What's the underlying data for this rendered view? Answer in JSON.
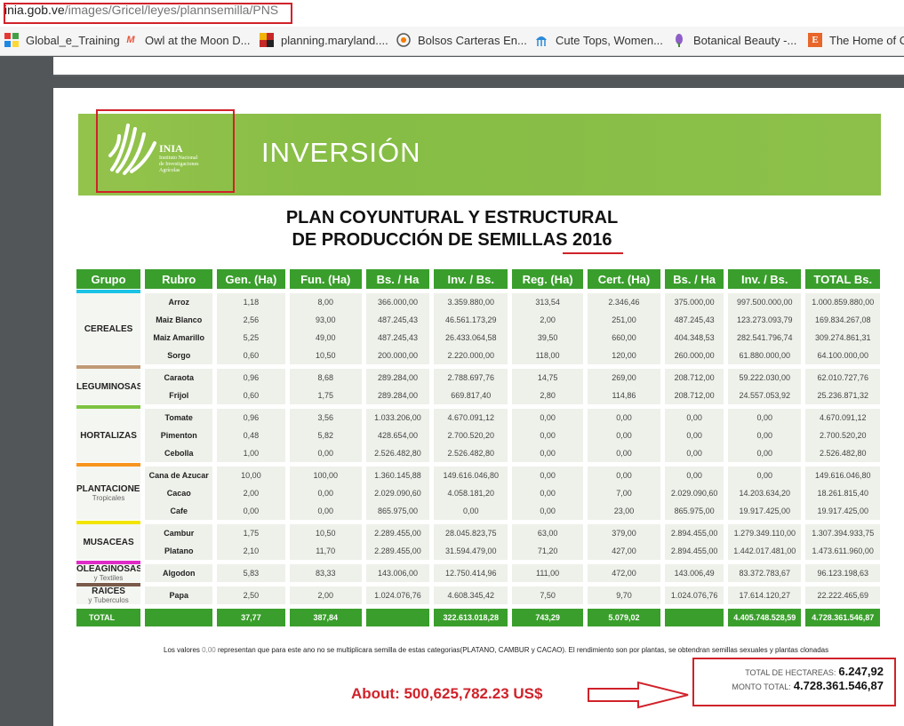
{
  "browser": {
    "url_domain": "inia.gob.ve",
    "url_path": "/images/Gricel/leyes/plannsemilla/PNS"
  },
  "bookmarks": [
    {
      "label": "Global_e_Training",
      "icon": "grid-icon"
    },
    {
      "label": "Owl at the Moon D...",
      "icon": "m-logo-icon"
    },
    {
      "label": "planning.maryland....",
      "icon": "maryland-flag-icon"
    },
    {
      "label": "Bolsos Carteras En...",
      "icon": "circle-logo-icon"
    },
    {
      "label": "Cute Tops, Women...",
      "icon": "jellyfish-icon"
    },
    {
      "label": "Botanical Beauty -...",
      "icon": "flower-icon"
    },
    {
      "label": "The Home of Cr",
      "icon": "e-logo-icon"
    }
  ],
  "document": {
    "logo_name": "INIA",
    "logo_sub": [
      "Instituto Nacional",
      "de Investigaciones",
      "Agrícolas"
    ],
    "banner_title": "INVERSIÓN",
    "title_line1": "PLAN COYUNTURAL Y ESTRUCTURAL",
    "title_line2_prefix": "DE PRODUCCIÓN DE SEMILLAS ",
    "title_year": "2016",
    "headers": [
      "Grupo",
      "Rubro",
      "Gen. (Ha)",
      "Fun. (Ha)",
      "Bs. / Ha",
      "Inv. / Bs.",
      "Reg. (Ha)",
      "Cert. (Ha)",
      "Bs. / Ha",
      "Inv. / Bs.",
      "TOTAL Bs."
    ],
    "groups": [
      {
        "name": "CEREALES",
        "sub": "",
        "color": "#19c3e6",
        "rows": [
          [
            "Arroz",
            "1,18",
            "8,00",
            "366.000,00",
            "3.359.880,00",
            "313,54",
            "2.346,46",
            "375.000,00",
            "997.500.000,00",
            "1.000.859.880,00"
          ],
          [
            "Maiz Blanco",
            "2,56",
            "93,00",
            "487.245,43",
            "46.561.173,29",
            "2,00",
            "251,00",
            "487.245,43",
            "123.273.093,79",
            "169.834.267,08"
          ],
          [
            "Maiz Amarillo",
            "5,25",
            "49,00",
            "487.245,43",
            "26.433.064,58",
            "39,50",
            "660,00",
            "404.348,53",
            "282.541.796,74",
            "309.274.861,31"
          ],
          [
            "Sorgo",
            "0,60",
            "10,50",
            "200.000,00",
            "2.220.000,00",
            "118,00",
            "120,00",
            "260.000,00",
            "61.880.000,00",
            "64.100.000,00"
          ]
        ]
      },
      {
        "name": "LEGUMINOSAS",
        "sub": "",
        "color": "#c09a76",
        "rows": [
          [
            "Caraota",
            "0,96",
            "8,68",
            "289.284,00",
            "2.788.697,76",
            "14,75",
            "269,00",
            "208.712,00",
            "59.222.030,00",
            "62.010.727,76"
          ],
          [
            "Frijol",
            "0,60",
            "1,75",
            "289.284,00",
            "669.817,40",
            "2,80",
            "114,86",
            "208.712,00",
            "24.557.053,92",
            "25.236.871,32"
          ]
        ]
      },
      {
        "name": "HORTALIZAS",
        "sub": "",
        "color": "#7dc242",
        "rows": [
          [
            "Tomate",
            "0,96",
            "3,56",
            "1.033.206,00",
            "4.670.091,12",
            "0,00",
            "0,00",
            "0,00",
            "0,00",
            "4.670.091,12"
          ],
          [
            "Pimenton",
            "0,48",
            "5,82",
            "428.654,00",
            "2.700.520,20",
            "0,00",
            "0,00",
            "0,00",
            "0,00",
            "2.700.520,20"
          ],
          [
            "Cebolla",
            "1,00",
            "0,00",
            "2.526.482,80",
            "2.526.482,80",
            "0,00",
            "0,00",
            "0,00",
            "0,00",
            "2.526.482,80"
          ]
        ]
      },
      {
        "name": "PLANTACIONES",
        "sub": "Tropicales",
        "color": "#f7941d",
        "rows": [
          [
            "Cana de Azucar",
            "10,00",
            "100,00",
            "1.360.145,88",
            "149.616.046,80",
            "0,00",
            "0,00",
            "0,00",
            "0,00",
            "149.616.046,80"
          ],
          [
            "Cacao",
            "2,00",
            "0,00",
            "2.029.090,60",
            "4.058.181,20",
            "0,00",
            "7,00",
            "2.029.090,60",
            "14.203.634,20",
            "18.261.815,40"
          ],
          [
            "Cafe",
            "0,00",
            "0,00",
            "865.975,00",
            "0,00",
            "0,00",
            "23,00",
            "865.975,00",
            "19.917.425,00",
            "19.917.425,00"
          ]
        ]
      },
      {
        "name": "MUSACEAS",
        "sub": "",
        "color": "#f2e500",
        "rows": [
          [
            "Cambur",
            "1,75",
            "10,50",
            "2.289.455,00",
            "28.045.823,75",
            "63,00",
            "379,00",
            "2.894.455,00",
            "1.279.349.110,00",
            "1.307.394.933,75"
          ],
          [
            "Platano",
            "2,10",
            "11,70",
            "2.289.455,00",
            "31.594.479,00",
            "71,20",
            "427,00",
            "2.894.455,00",
            "1.442.017.481,00",
            "1.473.611.960,00"
          ]
        ]
      },
      {
        "name": "OLEAGINOSAS",
        "sub": "y Textiles",
        "color": "#e02ac8",
        "rows": [
          [
            "Algodon",
            "5,83",
            "83,33",
            "143.006,00",
            "12.750.414,96",
            "111,00",
            "472,00",
            "143.006,49",
            "83.372.783,67",
            "96.123.198,63"
          ]
        ]
      },
      {
        "name": "RAICES",
        "sub": "y Tuberculos",
        "color": "#7a5a4a",
        "rows": [
          [
            "Papa",
            "2,50",
            "2,00",
            "1.024.076,76",
            "4.608.345,42",
            "7,50",
            "9,70",
            "1.024.076,76",
            "17.614.120,27",
            "22.222.465,69"
          ]
        ]
      }
    ],
    "total_row": [
      "TOTAL",
      "",
      "37,77",
      "387,84",
      "",
      "322.613.018,28",
      "743,29",
      "5.079,02",
      "",
      "4.405.748.528,59",
      "4.728.361.546,87"
    ],
    "note_prefix": "Los valores ",
    "note_zero": "0,00",
    "note_suffix": " representan que para este ano no se multiplicara semilla de estas categorias(PLATANO, CAMBUR y CACAO). El rendimiento son por plantas, se obtendran semillas sexuales y plantas clonadas",
    "total_hectareas_label": "TOTAL DE HECTAREAS:",
    "total_hectareas_value": "6.247,92",
    "monto_total_label": "MONTO TOTAL:",
    "monto_total_value": "4.728.361.546,87"
  },
  "annotation": {
    "about_text": "About: 500,625,782.23 US$",
    "color": "#d0222a"
  }
}
